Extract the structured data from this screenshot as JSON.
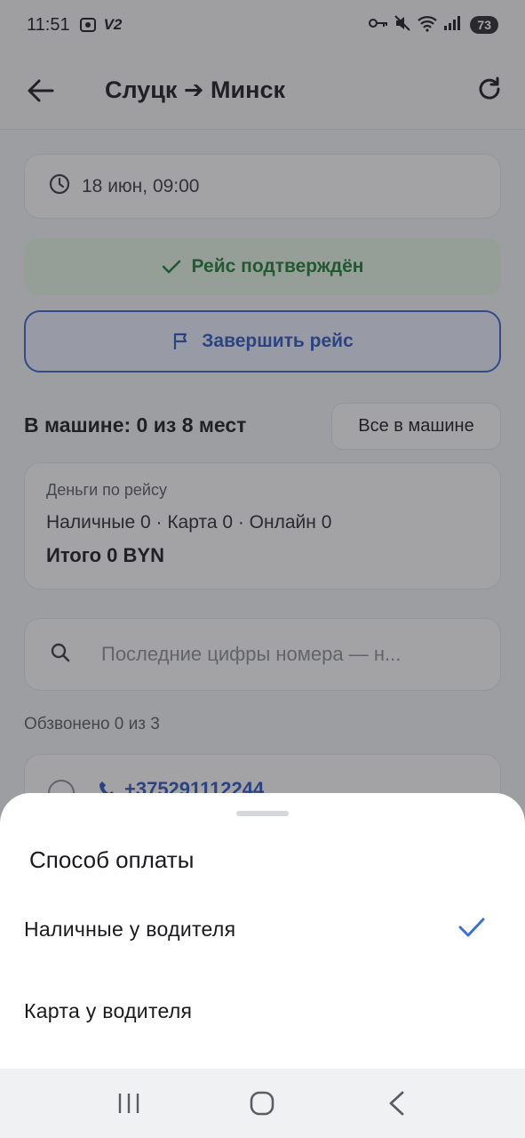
{
  "status_bar": {
    "time": "11:51",
    "v2_label": "V2",
    "battery": "73"
  },
  "header": {
    "title": "Слуцк ➔ Минск"
  },
  "trip": {
    "datetime": "18 июн, 09:00",
    "status": "Рейс подтверждён",
    "finish_label": "Завершить рейс"
  },
  "seats": {
    "label": "В машине: 0 из 8 мест",
    "all_in_label": "Все в машине"
  },
  "money": {
    "title": "Деньги по рейсу",
    "breakdown": "Наличные 0 · Карта 0 · Онлайн 0",
    "total": "Итого 0 BYN"
  },
  "search": {
    "placeholder": "Последние цифры номера — н..."
  },
  "calls": {
    "label": "Обзвонено 0 из 3"
  },
  "passenger": {
    "phone": "+375291112244"
  },
  "payment_sheet": {
    "title": "Способ оплаты",
    "options": [
      {
        "label": "Наличные у водителя",
        "selected": true
      },
      {
        "label": "Карта у водителя",
        "selected": false
      }
    ]
  },
  "colors": {
    "accent": "#2f56be",
    "success": "#1f7a38",
    "check": "#3a6fd8"
  },
  "icons": {
    "back": "arrow-left-icon",
    "refresh": "refresh-icon",
    "clock": "clock-icon",
    "check": "check-icon",
    "flag": "flag-icon",
    "search": "search-icon",
    "phone": "phone-icon",
    "nav_recents": "recents-icon",
    "nav_home": "home-icon",
    "nav_back": "back-chevron-icon"
  }
}
